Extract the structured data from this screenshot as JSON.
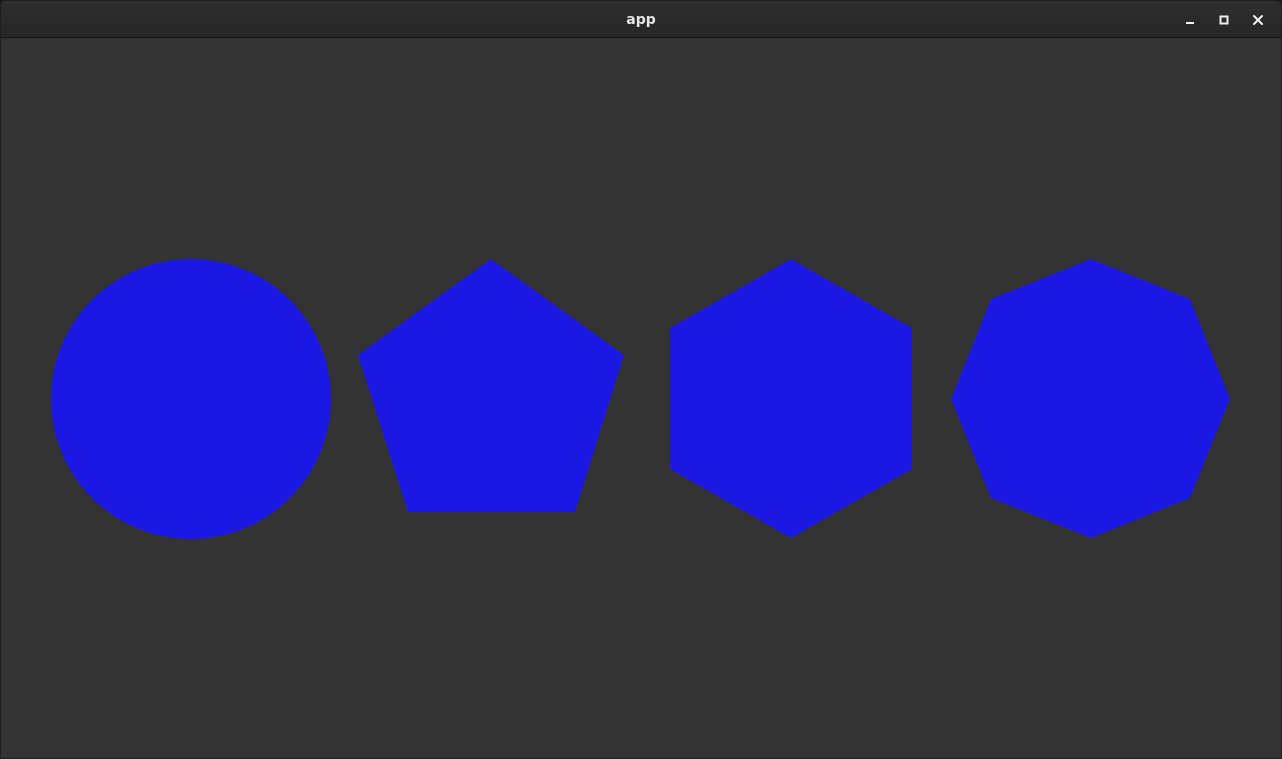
{
  "window": {
    "title": "app"
  },
  "titlebar_icons": {
    "minimize": "minimize-icon",
    "maximize": "maximize-icon",
    "close": "close-icon"
  },
  "colors": {
    "background": "#333333",
    "shape_fill": "#1b18e3",
    "titlebar": "#2a2a2a",
    "title_text": "#e6e6e6"
  },
  "shapes": [
    {
      "kind": "circle"
    },
    {
      "kind": "pentagon"
    },
    {
      "kind": "hexagon"
    },
    {
      "kind": "octagon"
    }
  ]
}
